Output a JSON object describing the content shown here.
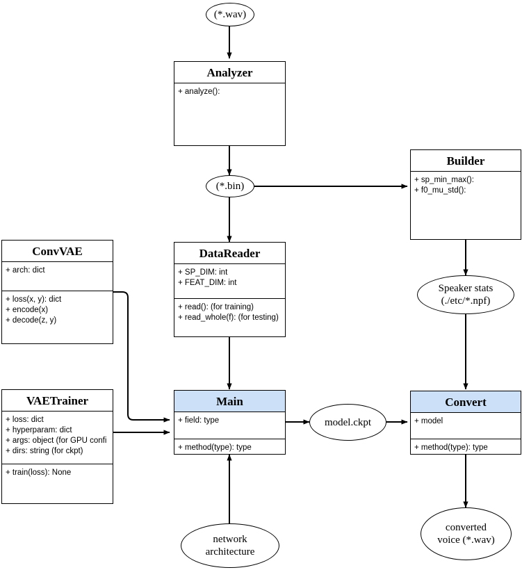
{
  "diagram": {
    "title": "VAE voice conversion class diagram",
    "accent_header_color": "#cce0f7",
    "line_color": "#000000"
  },
  "nodes": {
    "wav_input": {
      "label": "(*.wav)"
    },
    "analyzer": {
      "title": "Analyzer",
      "attributes": [],
      "methods": [
        "+ analyze():"
      ]
    },
    "bin": {
      "label": "(*.bin)"
    },
    "builder": {
      "title": "Builder",
      "attributes": [],
      "methods": [
        "+ sp_min_max():",
        "+ f0_mu_std():"
      ]
    },
    "convvae": {
      "title": "ConvVAE",
      "attributes": [
        "+ arch: dict"
      ],
      "methods": [
        "+ loss(x, y): dict",
        "+ encode(x)",
        "+ decode(z, y)"
      ]
    },
    "datareader": {
      "title": "DataReader",
      "attributes": [
        "+ SP_DIM: int",
        "+ FEAT_DIM: int"
      ],
      "methods": [
        "+ read(): (for training)",
        "+ read_whole(f): (for testing)"
      ]
    },
    "speaker_stats": {
      "line1": "Speaker stats",
      "line2": "(./etc/*.npf)"
    },
    "vaetrainer": {
      "title": "VAETrainer",
      "attributes": [
        "+ loss: dict",
        "+ hyperparam: dict",
        "+ args: object (for GPU confi",
        "+ dirs: string (for ckpt)"
      ],
      "methods": [
        "+ train(loss): None"
      ]
    },
    "main": {
      "title": "Main",
      "attributes": [
        "+ field: type"
      ],
      "methods": [
        "+ method(type): type"
      ]
    },
    "model_ckpt": {
      "label": "model.ckpt"
    },
    "convert": {
      "title": "Convert",
      "attributes": [
        "+ model"
      ],
      "methods": [
        "+ method(type): type"
      ]
    },
    "network_architecture": {
      "line1": "network",
      "line2": "architecture"
    },
    "converted_voice": {
      "line1": "converted",
      "line2": "voice (*.wav)"
    }
  }
}
